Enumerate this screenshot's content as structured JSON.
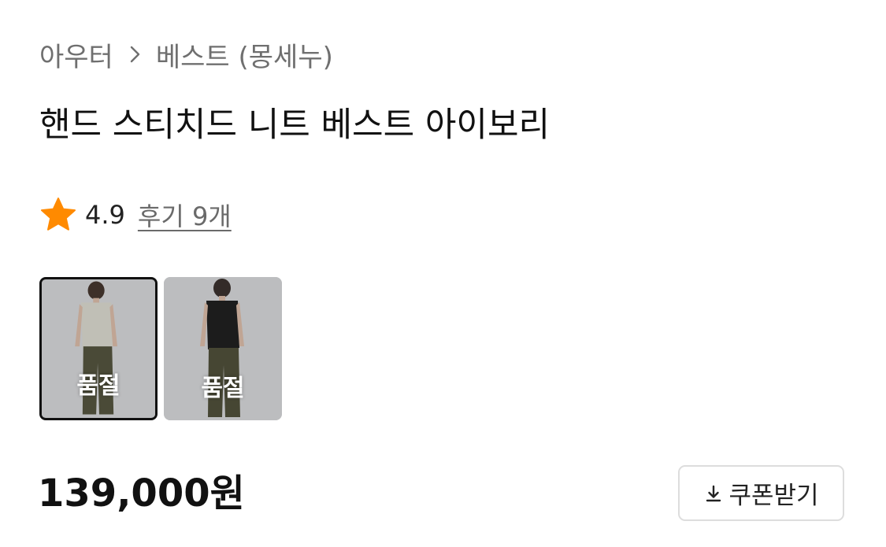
{
  "breadcrumb": {
    "category": "아우터",
    "separator_icon": "chevron-right-icon",
    "subcategory": "베스트 (몽세누)"
  },
  "product": {
    "title": "핸드 스티치드 니트 베스트 아이보리",
    "rating": {
      "icon": "star-icon",
      "star_color": "#FF8A00",
      "score": "4.9",
      "reviews_label": "후기 9개"
    },
    "options": [
      {
        "color": "아이보리",
        "status": "품절",
        "selected": true,
        "vest_color": "#d9d8ce"
      },
      {
        "color": "블랙",
        "status": "품절",
        "selected": false,
        "vest_color": "#121212"
      }
    ],
    "price": "139,000원",
    "coupon_button": {
      "icon": "download-icon",
      "label": "쿠폰받기"
    }
  }
}
